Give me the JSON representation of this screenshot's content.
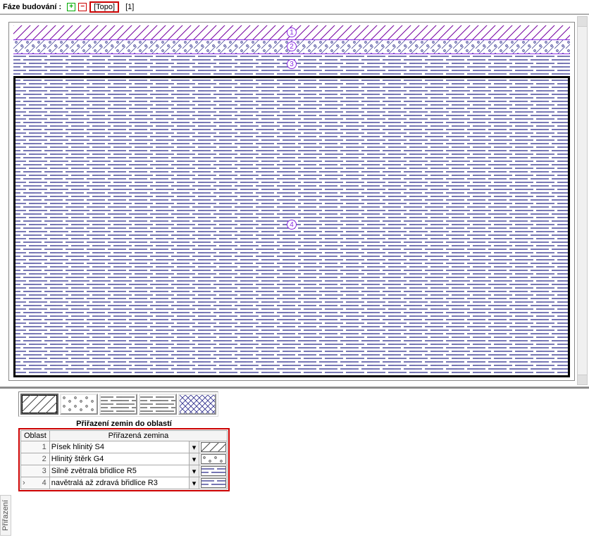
{
  "toolbar": {
    "label": "Fáze budování :",
    "stage_topo": "[Topo]",
    "stage_1": "[1]"
  },
  "layers": {
    "l1": "1",
    "l2": "2",
    "l3": "3",
    "l4": "4"
  },
  "panel_title": "Přiřazení zemin do oblastí",
  "columns": {
    "oblast": "Oblast",
    "zemina": "Přiřazená zemina"
  },
  "rows": {
    "r1_num": "1",
    "r2_num": "2",
    "r3_num": "3",
    "r4_num": "4",
    "r1": "Písek hlinitý  S4",
    "r2": "Hlinitý štěrk G4",
    "r3": "Silně zvětralá břidlice R5",
    "r4": "navětralá až zdravá břidlice R3"
  },
  "side_tab": "Přiřazení",
  "patterns": {
    "hatch": "hatch",
    "dots": "dots",
    "hdash": "hdash",
    "cross": "cross"
  }
}
